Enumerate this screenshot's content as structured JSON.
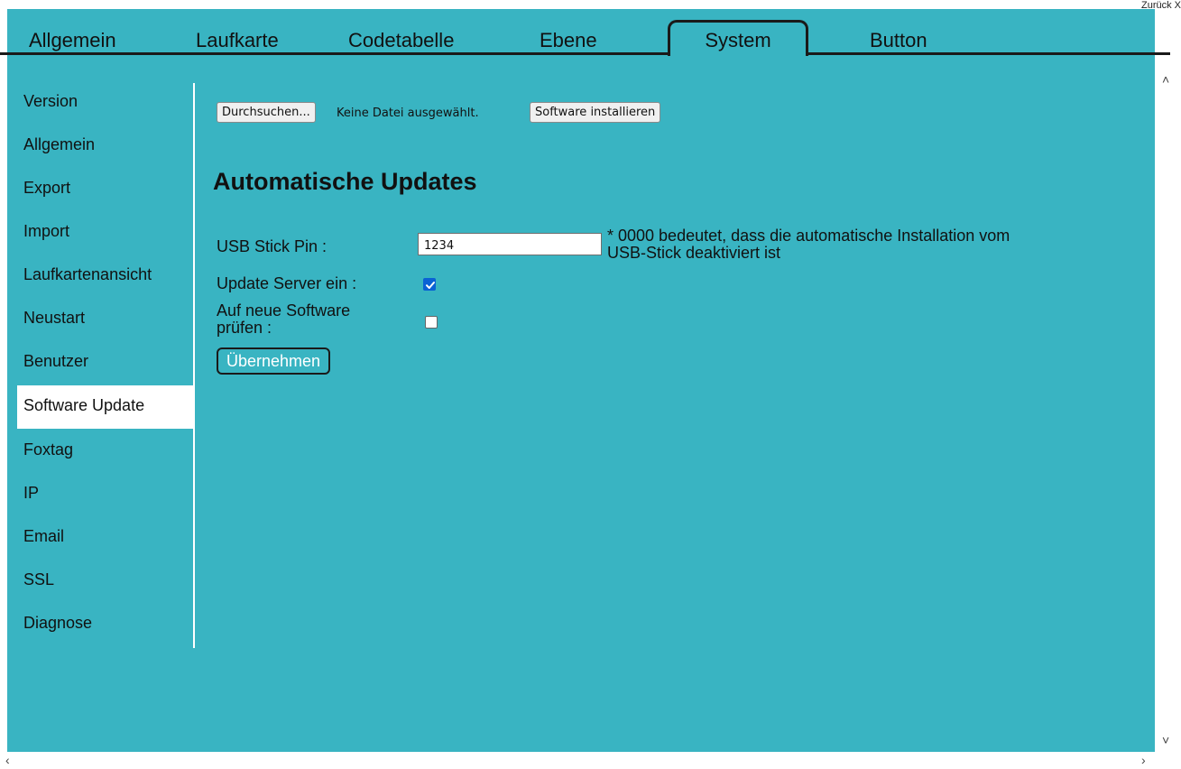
{
  "header": {
    "close_label": "Zurück X"
  },
  "tabs": [
    {
      "label": "Allgemein",
      "active": false
    },
    {
      "label": "Laufkarte",
      "active": false
    },
    {
      "label": "Codetabelle",
      "active": false
    },
    {
      "label": "Ebene",
      "active": false
    },
    {
      "label": "System",
      "active": true
    },
    {
      "label": "Button",
      "active": false
    }
  ],
  "sidebar": {
    "items": [
      {
        "label": "Version"
      },
      {
        "label": "Allgemein"
      },
      {
        "label": "Export"
      },
      {
        "label": "Import"
      },
      {
        "label": "Laufkartenansicht"
      },
      {
        "label": "Neustart"
      },
      {
        "label": "Benutzer"
      },
      {
        "label": "Software Update",
        "active": true
      },
      {
        "label": "Foxtag"
      },
      {
        "label": "IP"
      },
      {
        "label": "Email"
      },
      {
        "label": "SSL"
      },
      {
        "label": "Diagnose"
      }
    ]
  },
  "upload": {
    "browse_label": "Durchsuchen...",
    "no_file_text": "Keine Datei ausgewählt.",
    "install_label": "Software installieren"
  },
  "auto_updates": {
    "title": "Automatische Updates",
    "usb_pin_label": "USB Stick Pin :",
    "usb_pin_value": "1234",
    "usb_pin_note_line1": "* 0000 bedeutet, dass die automatische Installation vom",
    "usb_pin_note_line2": "USB-Stick deaktiviert ist",
    "update_server_label": "Update Server ein :",
    "update_server_checked": true,
    "check_software_label_line1": "Auf neue Software",
    "check_software_label_line2": "prüfen :",
    "check_software_checked": false,
    "apply_label": "Übernehmen"
  },
  "colors": {
    "background": "#39b4c2",
    "active_item_bg": "#ffffff",
    "checkbox_checked": "#0a62d4"
  }
}
